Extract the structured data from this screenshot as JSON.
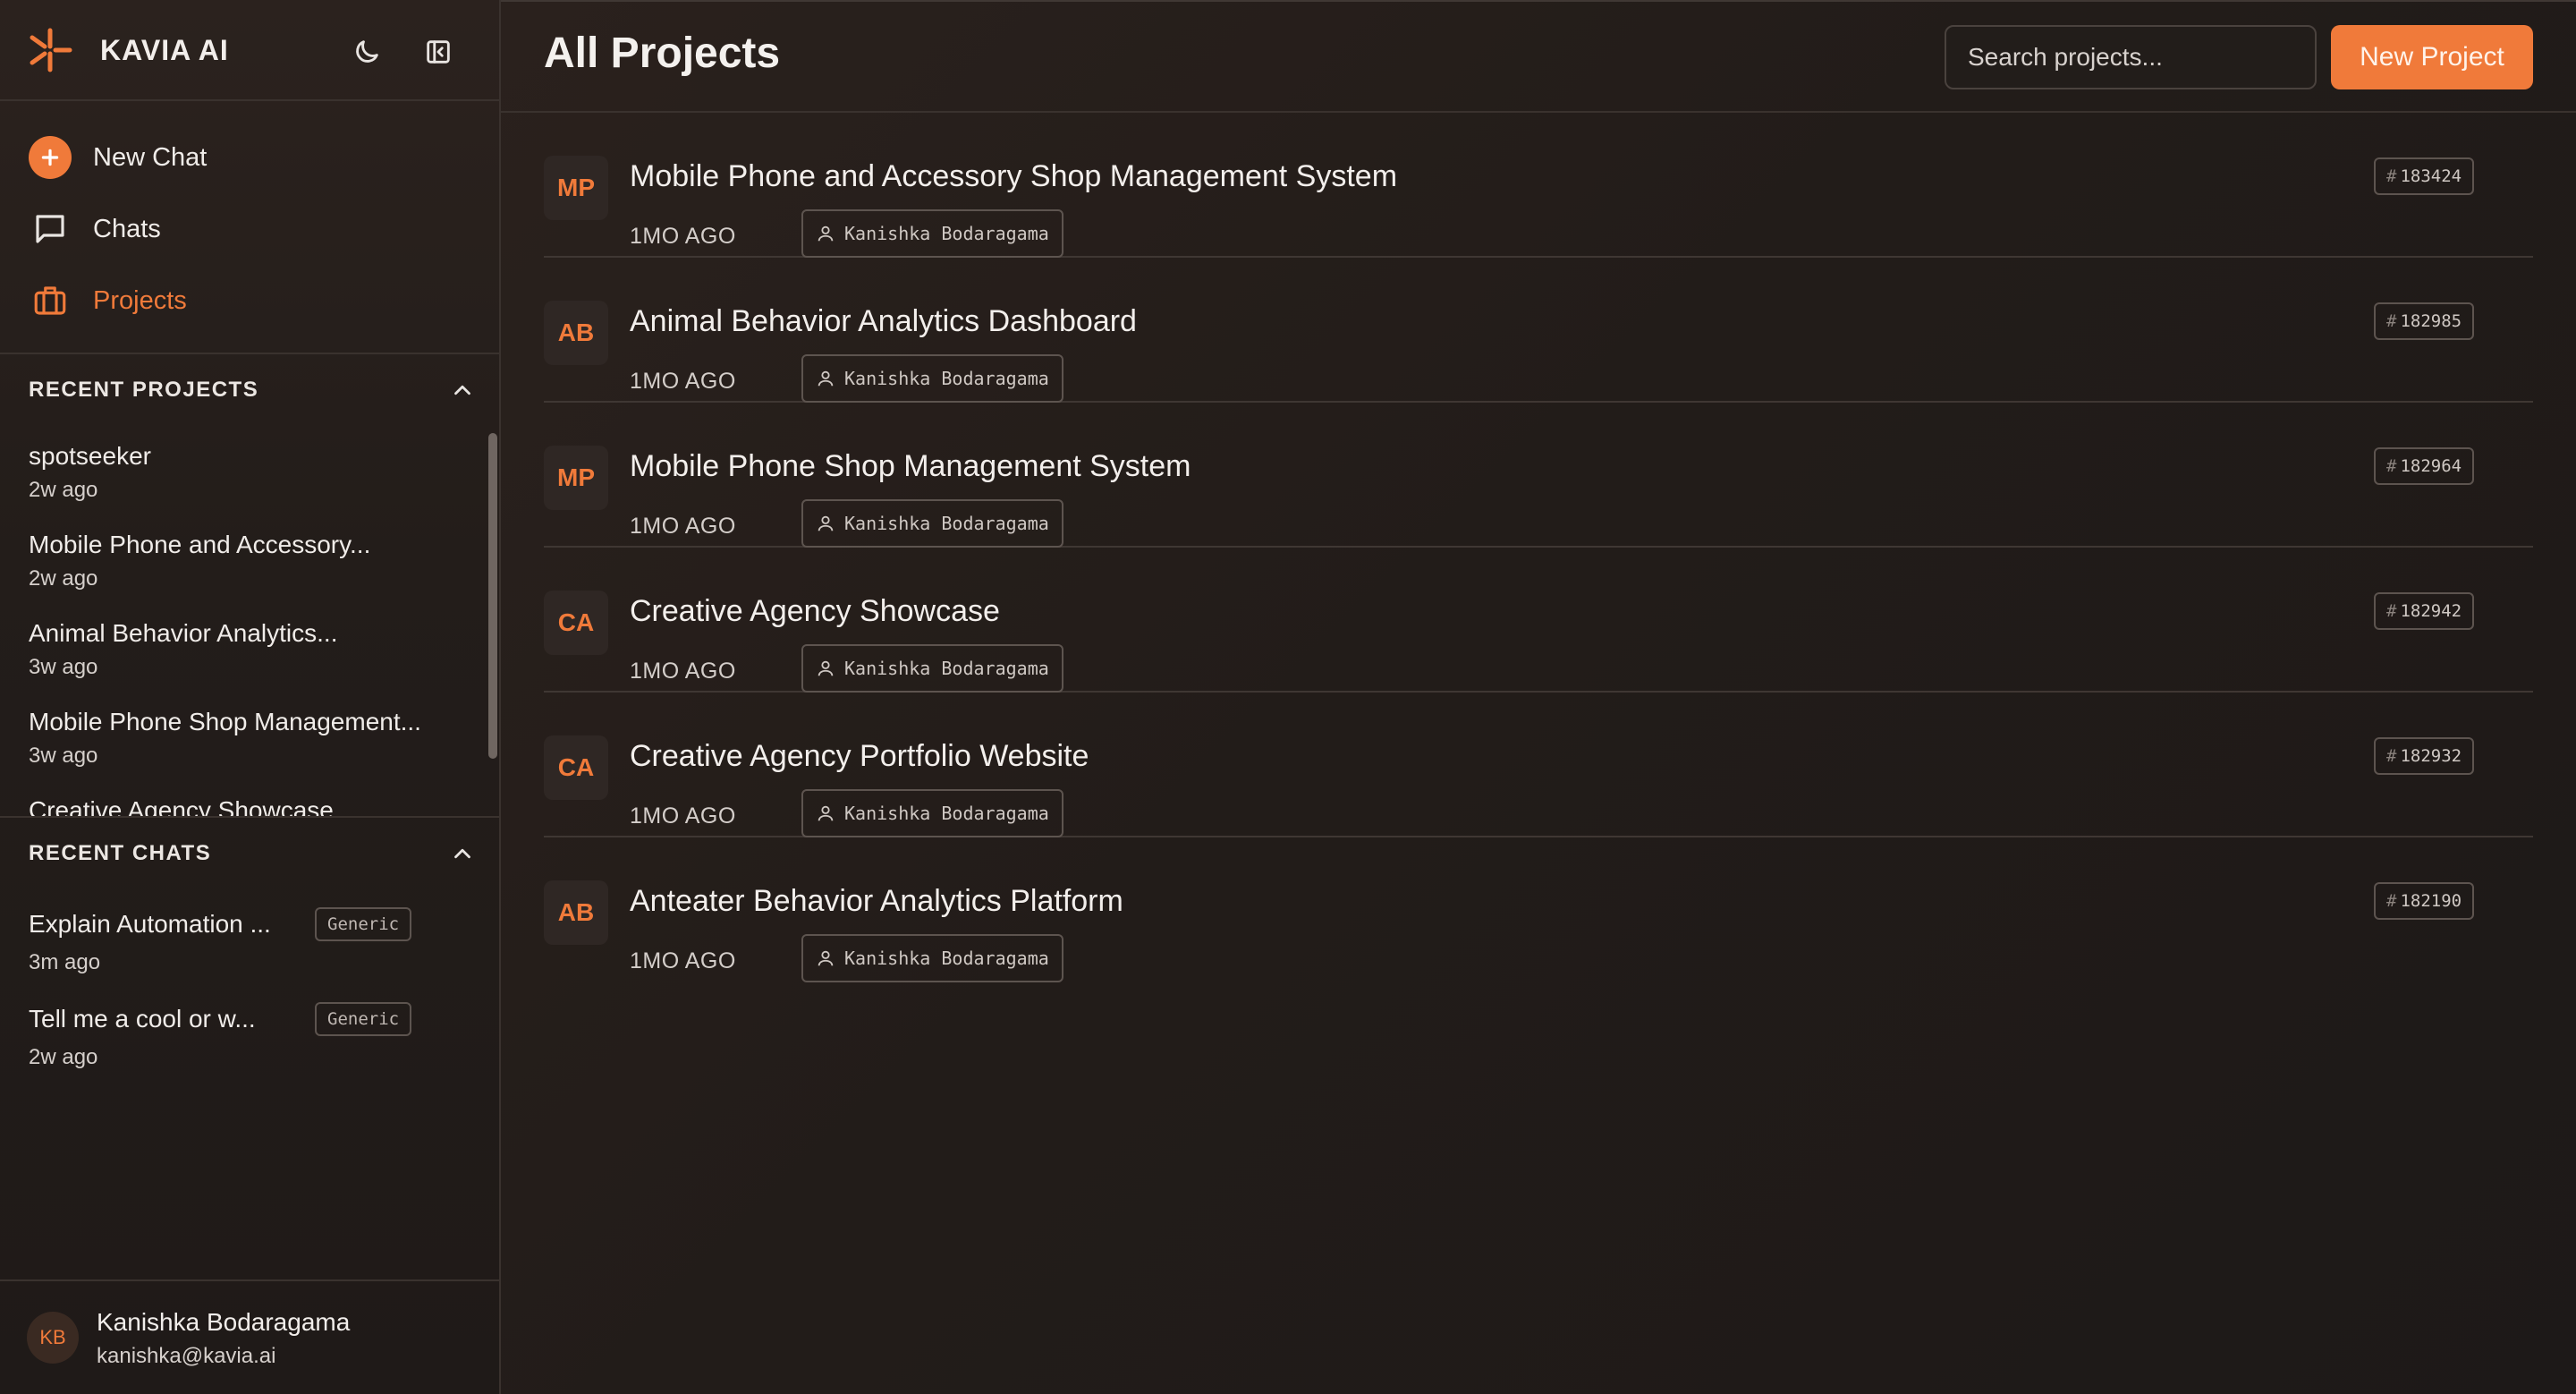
{
  "app": {
    "name": "KAVIA AI",
    "accent_color": "#f07a3a"
  },
  "nav": {
    "new_chat": "New Chat",
    "chats": "Chats",
    "projects": "Projects"
  },
  "recent_projects": {
    "heading": "RECENT PROJECTS",
    "items": [
      {
        "title": "spotseeker",
        "time": "2w ago"
      },
      {
        "title": "Mobile Phone and Accessory...",
        "time": "2w ago"
      },
      {
        "title": "Animal Behavior Analytics...",
        "time": "3w ago"
      },
      {
        "title": "Mobile Phone Shop Management...",
        "time": "3w ago"
      },
      {
        "title": "Creative Agency Showcase",
        "time": ""
      }
    ]
  },
  "recent_chats": {
    "heading": "RECENT CHATS",
    "items": [
      {
        "title": "Explain Automation ...",
        "tag": "Generic",
        "time": "3m ago"
      },
      {
        "title": "Tell me a cool or w...",
        "tag": "Generic",
        "time": "2w ago"
      }
    ]
  },
  "user": {
    "initials": "KB",
    "name": "Kanishka Bodaragama",
    "email": "kanishka@kavia.ai"
  },
  "main": {
    "title": "All Projects",
    "search_placeholder": "Search projects...",
    "new_project_label": "New Project",
    "projects": [
      {
        "initials": "MP",
        "title": "Mobile Phone and Accessory Shop Management System",
        "time": "1MO AGO",
        "owner": "Kanishka Bodaragama",
        "id": "183424"
      },
      {
        "initials": "AB",
        "title": "Animal Behavior Analytics Dashboard",
        "time": "1MO AGO",
        "owner": "Kanishka Bodaragama",
        "id": "182985"
      },
      {
        "initials": "MP",
        "title": "Mobile Phone Shop Management System",
        "time": "1MO AGO",
        "owner": "Kanishka Bodaragama",
        "id": "182964"
      },
      {
        "initials": "CA",
        "title": "Creative Agency Showcase",
        "time": "1MO AGO",
        "owner": "Kanishka Bodaragama",
        "id": "182942"
      },
      {
        "initials": "CA",
        "title": "Creative Agency Portfolio Website",
        "time": "1MO AGO",
        "owner": "Kanishka Bodaragama",
        "id": "182932"
      },
      {
        "initials": "AB",
        "title": "Anteater Behavior Analytics Platform",
        "time": "1MO AGO",
        "owner": "Kanishka Bodaragama",
        "id": "182190"
      }
    ]
  }
}
